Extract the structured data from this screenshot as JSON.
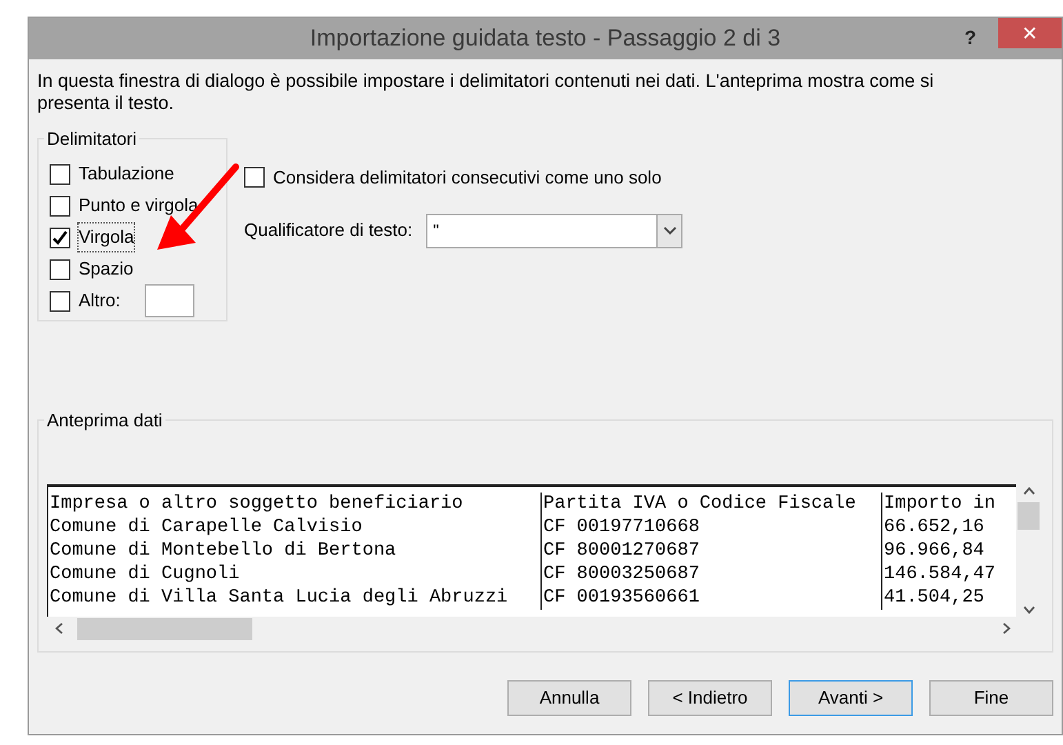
{
  "window": {
    "title": "Importazione guidata testo - Passaggio 2 di 3",
    "help": "?",
    "close": "✕"
  },
  "intro": "In questa finestra di dialogo è possibile impostare i delimitatori contenuti nei dati. L'anteprima mostra come si presenta il testo.",
  "delimiters": {
    "title": "Delimitatori",
    "items": [
      {
        "label": "Tabulazione",
        "checked": false,
        "kind": "plain"
      },
      {
        "label": "Punto e virgola",
        "checked": false,
        "kind": "plain"
      },
      {
        "label": "Virgola",
        "checked": true,
        "kind": "plain"
      },
      {
        "label": "Spazio",
        "checked": false,
        "kind": "plain"
      },
      {
        "label": "Altro:",
        "checked": false,
        "kind": "with_field"
      }
    ]
  },
  "consecutive": {
    "label": "Considera delimitatori consecutivi come uno solo",
    "checked": false
  },
  "qualifier": {
    "label": "Qualificatore di testo:",
    "value": "\""
  },
  "preview": {
    "title": "Anteprima dati",
    "rows": [
      [
        "Impresa o altro soggetto beneficiario",
        "Partita IVA o Codice Fiscale",
        "Importo in"
      ],
      [
        "Comune di Carapelle Calvisio",
        "CF 00197710668",
        "66.652,16"
      ],
      [
        "Comune di Montebello di Bertona",
        "CF 80001270687",
        "96.966,84"
      ],
      [
        "Comune di Cugnoli",
        "CF 80003250687",
        "146.584,47"
      ],
      [
        "Comune di Villa Santa Lucia degli Abruzzi",
        "CF 00193560661",
        "41.504,25"
      ]
    ]
  },
  "buttons": [
    {
      "label": "Annulla",
      "selected": false
    },
    {
      "label": "< Indietro",
      "selected": false
    },
    {
      "label": "Avanti >",
      "selected": true
    },
    {
      "label": "Fine",
      "selected": false
    }
  ]
}
